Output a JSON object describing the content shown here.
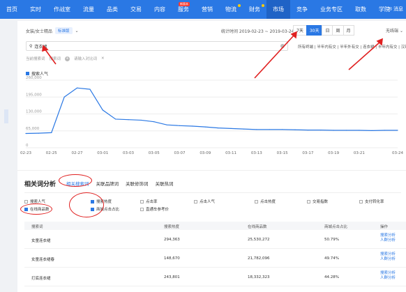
{
  "nav": {
    "items": [
      "首页",
      "实时",
      "作战室",
      "流量",
      "品类",
      "交易",
      "内容",
      "服务",
      "营销",
      "物流",
      "财务",
      "市场",
      "竞争",
      "业务专区",
      "取数",
      "学院"
    ],
    "active_index": 11,
    "badge_text": "新版本",
    "right_label": "消息"
  },
  "header": {
    "breadcrumb": "女装/女士精品",
    "tag": "标准版",
    "stat_time": "统计时间 2019-02-23 ~ 2019-03-24",
    "periods": [
      "7天",
      "30天",
      "日",
      "周",
      "月"
    ],
    "active_period": 1,
    "device": "无线端"
  },
  "search": {
    "value": "连衣裙",
    "filters": "所有终端 | 半年内有交 | 半年外有交 | 连衣裙 | 半年内有交 | 汉现"
  },
  "compare": {
    "label": "当前搜索词",
    "current": "搜索词",
    "placeholder": "请输入对比词"
  },
  "chart_data": {
    "type": "line",
    "series": [
      {
        "name": "搜索人气",
        "values": [
          55000,
          56000,
          58000,
          195000,
          230000,
          225000,
          145000,
          110000,
          108000,
          106000,
          100000,
          88000,
          85000,
          83000,
          80000,
          76000,
          74000,
          72000,
          70000,
          70000,
          70000,
          69000,
          68000,
          68000,
          67000,
          67000,
          67000,
          66000,
          67000,
          67000
        ]
      }
    ],
    "x": [
      "02-23",
      "02-24",
      "02-25",
      "02-26",
      "02-27",
      "02-28",
      "03-01",
      "03-02",
      "03-03",
      "03-04",
      "03-05",
      "03-06",
      "03-07",
      "03-08",
      "03-09",
      "03-10",
      "03-11",
      "03-12",
      "03-13",
      "03-14",
      "03-15",
      "03-16",
      "03-17",
      "03-18",
      "03-19",
      "03-20",
      "03-21",
      "03-22",
      "03-23",
      "03-24"
    ],
    "x_tick_labels": [
      "02-23",
      "02-25",
      "02-27",
      "03-01",
      "03-03",
      "03-05",
      "03-07",
      "03-09",
      "03-11",
      "03-13",
      "03-15",
      "03-17",
      "03-19",
      "03-21",
      "03-24"
    ],
    "y_tick_labels": [
      "0",
      "65,000",
      "130,000",
      "195,000",
      "260,000"
    ],
    "ylim": [
      0,
      260000
    ],
    "grid": true,
    "legend": "top-left",
    "color": "#2a78e4"
  },
  "related": {
    "title": "相关词分析",
    "tabs": [
      "相关搜索词",
      "关联品牌词",
      "关联修饰词",
      "关联热词"
    ],
    "active_tab": 0,
    "checkboxes": [
      {
        "label": "搜索人气",
        "checked": false
      },
      {
        "label": "搜索热度",
        "checked": true
      },
      {
        "label": "点击率",
        "checked": false
      },
      {
        "label": "点击人气",
        "checked": false
      },
      {
        "label": "点击热度",
        "checked": false
      },
      {
        "label": "交易指数",
        "checked": false
      },
      {
        "label": "支付转化率",
        "checked": false
      },
      {
        "label": "在线商品数",
        "checked": true
      },
      {
        "label": "商城点击占比",
        "checked": true
      },
      {
        "label": "直通车参考价",
        "checked": false
      }
    ],
    "columns": [
      "搜索词",
      "搜索热度",
      "在线商品数",
      "商城点击占比",
      "操作"
    ],
    "rows": [
      {
        "word": "女童连衣裙",
        "heat": "294,363",
        "items": "25,530,272",
        "ratio": "50.79%",
        "op1": "搜索分析",
        "op2": "人群分析"
      },
      {
        "word": "女童连衣裙春",
        "heat": "148,670",
        "items": "21,782,096",
        "ratio": "49.74%",
        "op1": "搜索分析",
        "op2": "人群分析"
      },
      {
        "word": "打底连衣裙",
        "heat": "243,801",
        "items": "18,332,323",
        "ratio": "44.28%",
        "op1": "搜索分析",
        "op2": "人群分析"
      }
    ]
  }
}
